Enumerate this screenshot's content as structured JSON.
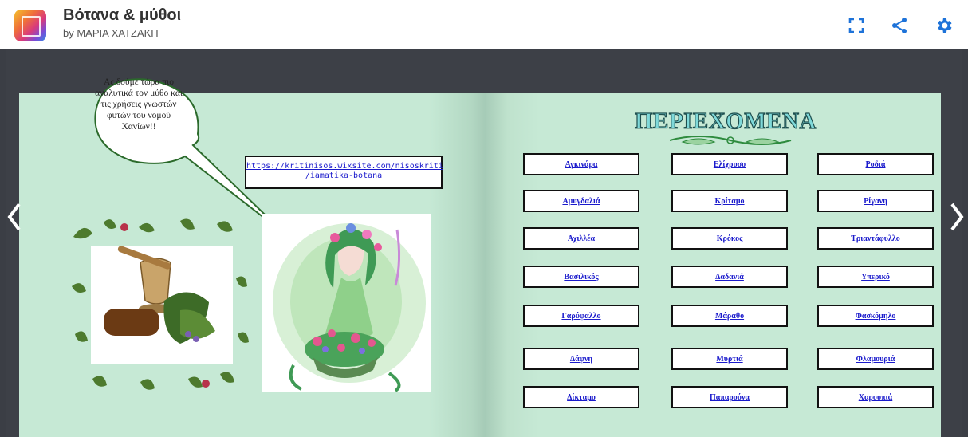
{
  "header": {
    "title": "Βότανα & μύθοι",
    "author": "by ΜΑΡΙΑ ΧΑΤΖΑΚΗ",
    "tools": [
      "fullscreen-icon",
      "share-icon",
      "gear-icon"
    ],
    "accent_color": "#1e73d9"
  },
  "left_page": {
    "bubble_text": "Ας δούμε τώρα πιο αναλυτικά τον μύθο και τις χρήσεις γνωστών φυτών του νομού Χανίων!!",
    "link_line1": "https://kritinisos.wixsite.com/nisoskriti",
    "link_line2": "/iamatika-botana"
  },
  "right_page": {
    "heading": "ΠΕΡΙΕΧΟΜΕΝΑ",
    "items": [
      "Αγκινάρα",
      "Ελίχρυσο",
      "Ροδιά",
      "Αμυγδαλιά",
      "Κρίταμο",
      "Ρίγανη",
      "Αχιλλέα",
      "Κρόκος",
      "Τριαντάφυλλο",
      "Βασιλικός",
      "Δαδανιά",
      "Υπερικό",
      "Γαρύφαλλο",
      "Μάραθο",
      "Φασκόμηλο",
      "Δάφνη",
      "Μυρτιά",
      "Φλαμουριά",
      "Δίκταμο",
      "Παπαρούνα",
      "Χαρουπιά"
    ]
  }
}
